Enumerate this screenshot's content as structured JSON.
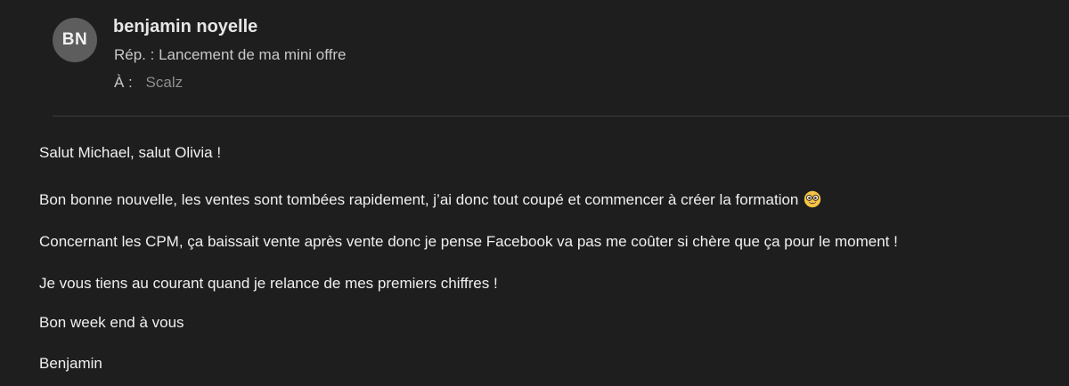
{
  "header": {
    "avatar_initials": "BN",
    "sender_name": "benjamin noyelle",
    "subject": "Rép. : Lancement de ma mini offre",
    "to_label": "À :",
    "to_value": "Scalz"
  },
  "body": {
    "greeting": "Salut Michael, salut Olivia !",
    "paragraph_1": "Bon bonne nouvelle, les ventes sont tombées rapidement, j’ai donc tout coupé et commencer à créer la formation",
    "paragraph_1_emoji": "nerd-face-emoji",
    "paragraph_2": "Concernant les CPM, ça baissait vente après vente donc je pense Facebook va pas me coûter si chère que ça pour le moment !",
    "paragraph_3": "Je vous tiens au courant quand je relance de mes premiers chiffres !",
    "closing": "Bon week end à vous",
    "signature": "Benjamin"
  },
  "colors": {
    "background": "#1e1e1e",
    "avatar": "#5d5d5d",
    "text": "#f0f0f0",
    "muted": "#8e8e8e"
  }
}
